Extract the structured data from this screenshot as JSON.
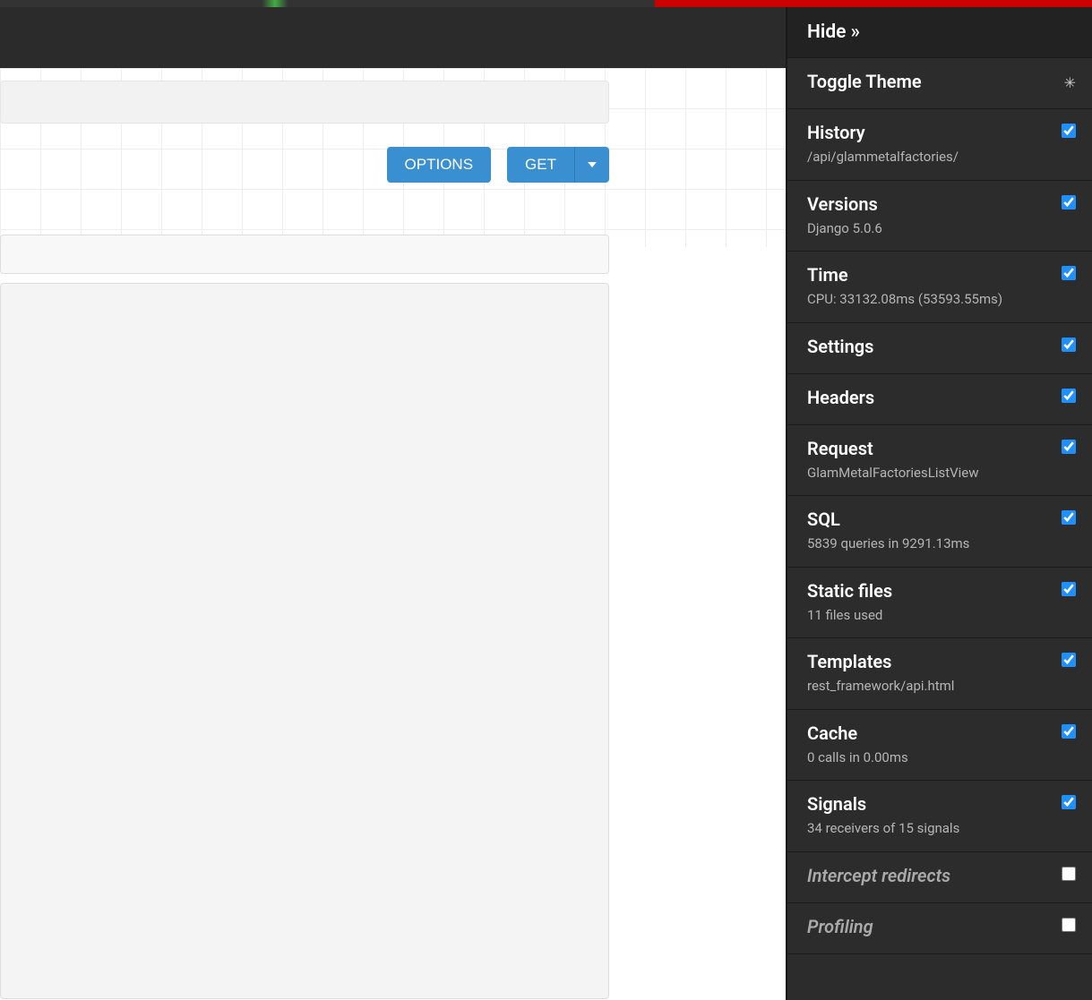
{
  "buttons": {
    "options": "OPTIONS",
    "get": "GET"
  },
  "debug": {
    "hide": "Hide »",
    "panels": [
      {
        "title": "Toggle Theme",
        "sub": "",
        "icon": "✳",
        "check": null,
        "dim": false
      },
      {
        "title": "History",
        "sub": "/api/glammetalfactories/",
        "check": true,
        "dim": false
      },
      {
        "title": "Versions",
        "sub": "Django 5.0.6",
        "check": true,
        "dim": false
      },
      {
        "title": "Time",
        "sub": "CPU: 33132.08ms (53593.55ms)",
        "check": true,
        "dim": false
      },
      {
        "title": "Settings",
        "sub": "",
        "check": true,
        "dim": false
      },
      {
        "title": "Headers",
        "sub": "",
        "check": true,
        "dim": false
      },
      {
        "title": "Request",
        "sub": "GlamMetalFactoriesListView",
        "check": true,
        "dim": false
      },
      {
        "title": "SQL",
        "sub": "5839 queries in 9291.13ms",
        "check": true,
        "dim": false
      },
      {
        "title": "Static files",
        "sub": "11 files used",
        "check": true,
        "dim": false
      },
      {
        "title": "Templates",
        "sub": "rest_framework/api.html",
        "check": true,
        "dim": false
      },
      {
        "title": "Cache",
        "sub": "0 calls in 0.00ms",
        "check": true,
        "dim": false
      },
      {
        "title": "Signals",
        "sub": "34 receivers of 15 signals",
        "check": true,
        "dim": false
      },
      {
        "title": "Intercept redirects",
        "sub": "",
        "check": false,
        "dim": true
      },
      {
        "title": "Profiling",
        "sub": "",
        "check": false,
        "dim": true
      }
    ]
  }
}
